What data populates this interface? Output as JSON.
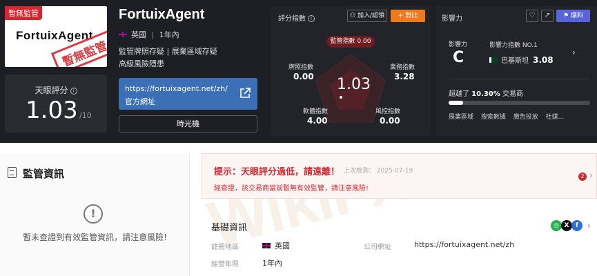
{
  "logo": {
    "tag": "暫無監管",
    "name": "FortuixAgent",
    "stamp": "暫無監管"
  },
  "score": {
    "label": "天眼評分",
    "value": "1.03",
    "max": "/10"
  },
  "company": {
    "name": "FortuixAgent",
    "country": "英國",
    "separator": "|",
    "years": "1年內",
    "line1": "監管牌照存疑 | 展業區域存疑",
    "line2": "高級風險隱患",
    "site_url": "https://fortuixagent.net/zh/",
    "site_label": "官方網址",
    "time_machine": "時光機"
  },
  "rating": {
    "title": "評分指數",
    "join_btn": "加入/認領",
    "compare_btn": "對比",
    "regulatory": "監管指數 0.00",
    "center": "1.03",
    "license_label": "牌照指數",
    "license_value": "0.00",
    "business_label": "業務指數",
    "business_value": "3.28",
    "software_label": "軟體指數",
    "software_value": "4.00",
    "risk_label": "風控指數",
    "risk_value": "0.00"
  },
  "influence": {
    "title": "影響力",
    "report_btn": "爆料",
    "grade_label": "影響力",
    "grade": "C",
    "index_label": "影響力指數 NO.1",
    "country": "巴基斯坦",
    "country_value": "3.08",
    "surpass_prefix": "超越了",
    "surpass_value": "10.30%",
    "surpass_suffix": "交易商",
    "progress": 0.103,
    "tags": [
      "展業區域",
      "搜索數據",
      "廣告投放",
      "社媒..."
    ]
  },
  "regulation": {
    "title": "監管資訊",
    "message": "暫未查證到有效監管資訊，請注意風險!"
  },
  "warning": {
    "title": "提示：天眼評分過低，請遠離！",
    "date": "上次檢測： 2025-07-19",
    "text": "經查證，該交易商當前暫無有效監管，請注意風險!",
    "count": "2"
  },
  "basic": {
    "title": "基礎資訊",
    "reg_label": "註冊地區",
    "reg_value": "英國",
    "site_label": "公司網址",
    "site_value": "https://fortuixagent.net/zh",
    "years_label": "經營年限",
    "years_value": "1年內"
  },
  "watermark": "WikiFX",
  "colors": {
    "accent_orange": "#ef7a1e",
    "warning_red": "#cf2b33",
    "report_blue": "#5964d9",
    "site_blue": "#3b6fb6"
  }
}
